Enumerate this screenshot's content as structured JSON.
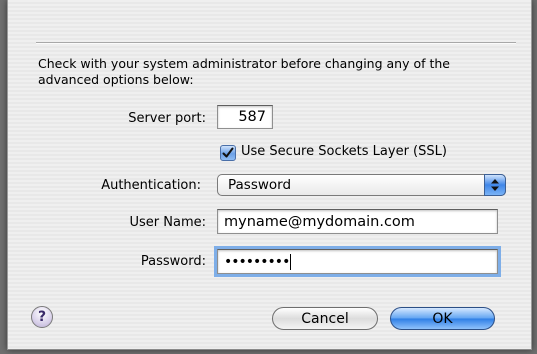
{
  "dialog": {
    "note": "Check with your system administrator before changing any of the advanced options below:",
    "server_port": {
      "label": "Server port:",
      "value": "587"
    },
    "ssl": {
      "label": "Use Secure Sockets Layer (SSL)",
      "checked": true
    },
    "authentication": {
      "label": "Authentication:",
      "selected": "Password"
    },
    "user_name": {
      "label": "User Name:",
      "value": "myname@mydomain.com"
    },
    "password": {
      "label": "Password:",
      "masked": "•••••••••"
    },
    "buttons": {
      "help": "?",
      "cancel": "Cancel",
      "ok": "OK"
    }
  }
}
